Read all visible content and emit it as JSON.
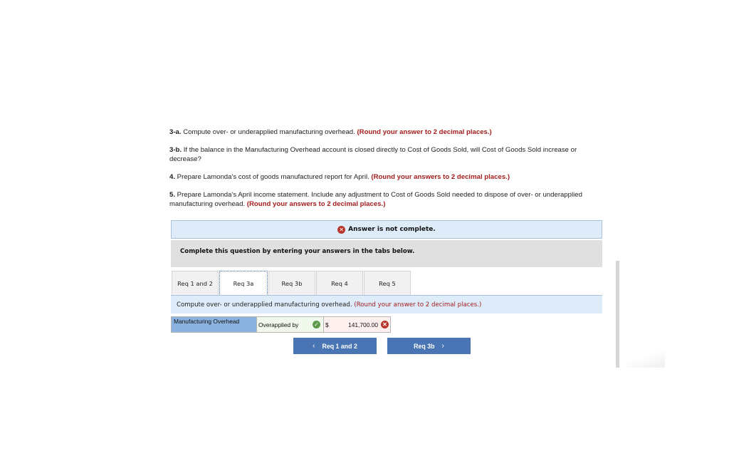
{
  "instructions": [
    {
      "num": "3-a.",
      "text": " Compute over- or underapplied manufacturing overhead. ",
      "note": "(Round your answer to 2 decimal places.)"
    },
    {
      "num": "3-b.",
      "text": " If the balance in the Manufacturing Overhead account is closed directly to Cost of Goods Sold, will Cost of Goods Sold increase or decrease?",
      "note": ""
    },
    {
      "num": "4.",
      "text": " Prepare Lamonda's cost of goods manufactured report for April. ",
      "note": "(Round your answers to 2 decimal places.)"
    },
    {
      "num": "5.",
      "text": " Prepare Lamonda's April income statement. Include any adjustment to Cost of Goods Sold needed to dispose of over- or underapplied manufacturing overhead. ",
      "note": "(Round your answers to 2 decimal places.)"
    }
  ],
  "alert": {
    "icon": "x-circle-icon",
    "text": "Answer is not complete."
  },
  "instruction_bar": "Complete this question by entering your answers in the tabs below.",
  "tabs": [
    {
      "label": "Req 1 and 2",
      "active": false
    },
    {
      "label": "Req 3a",
      "active": true
    },
    {
      "label": "Req 3b",
      "active": false
    },
    {
      "label": "Req 4",
      "active": false
    },
    {
      "label": "Req 5",
      "active": false
    }
  ],
  "content": {
    "prompt": "Compute over- or underapplied manufacturing overhead. ",
    "note": "(Round your answer to 2 decimal places.)"
  },
  "answer_row": {
    "label": "Manufacturing Overhead",
    "selection": "Overapplied by",
    "selection_status": "correct",
    "currency": "$",
    "amount": "141,700.00",
    "amount_status": "incorrect"
  },
  "nav": {
    "prev_label": "Req 1 and 2",
    "next_label": "Req 3b",
    "prev_chevron": "‹",
    "next_chevron": "›"
  },
  "colors": {
    "note_red": "#a51c1c",
    "button_blue": "#4a75b5",
    "alert_bg": "#deebf8",
    "label_blue": "#8cb3e0",
    "correct_green": "#5f9a4a",
    "incorrect_red": "#b9342c"
  }
}
